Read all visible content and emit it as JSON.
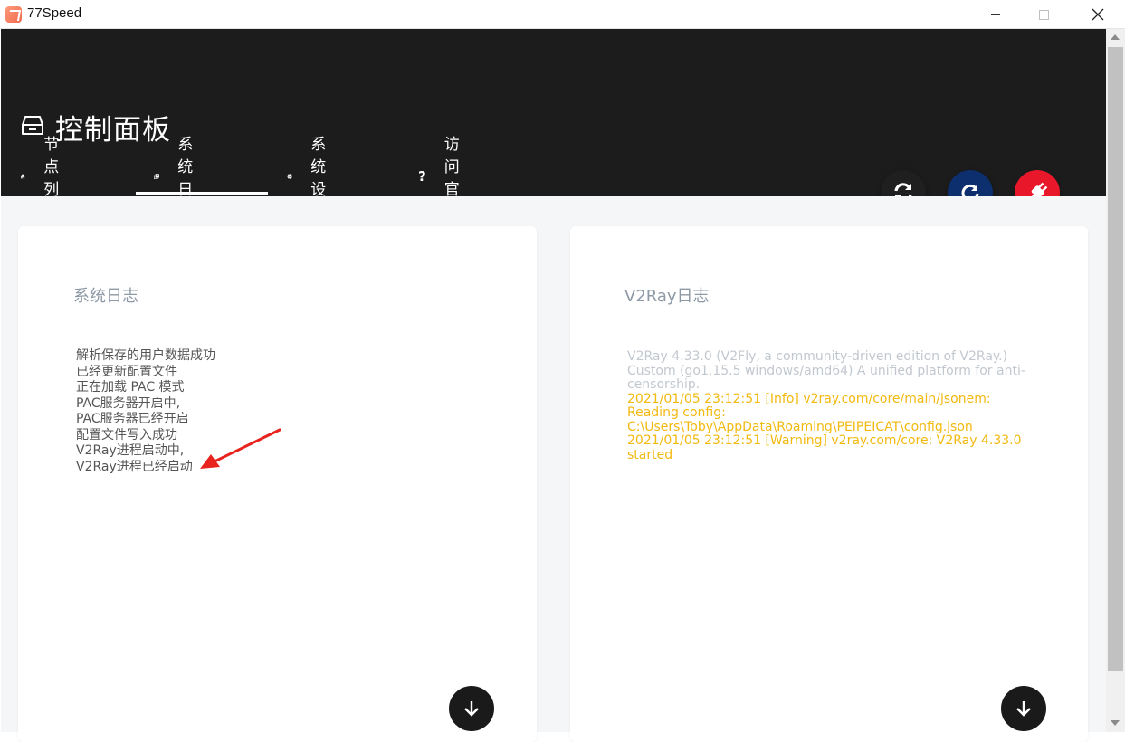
{
  "window": {
    "title": "77Speed",
    "close_glyph": "✕"
  },
  "header": {
    "title": "控制面板",
    "icon": "inbox-icon"
  },
  "tabs": [
    {
      "label": "节点列表",
      "icon": "home-icon",
      "glyph": "⌂"
    },
    {
      "label": "系统日志",
      "icon": "library-icon",
      "glyph": "❐",
      "active": true
    },
    {
      "label": "系统设置",
      "icon": "gear-icon",
      "glyph": "⚙"
    },
    {
      "label": "访问官网",
      "icon": "question-icon",
      "glyph": "?"
    }
  ],
  "actions": [
    {
      "icon": "sync-icon",
      "color": "#1f1f1f"
    },
    {
      "icon": "refresh-icon",
      "color": "#0d2f6e"
    },
    {
      "icon": "plug-icon",
      "color": "#e8172a"
    }
  ],
  "system_log": {
    "title": "系统日志",
    "lines": [
      "解析保存的用户数据成功",
      "已经更新配置文件",
      "正在加载 PAC 模式",
      "PAC服务器开启中,",
      "PAC服务器已经开启",
      "配置文件写入成功",
      "V2Ray进程启动中,",
      "V2Ray进程已经启动"
    ]
  },
  "v2ray_log": {
    "title": "V2Ray日志",
    "intro": "V2Ray 4.33.0 (V2Fly, a community-driven edition of V2Ray.) Custom (go1.15.5 windows/amd64) A unified platform for anti-censorship.",
    "entries": "2021/01/05 23:12:51 [Info] v2ray.com/core/main/jsonem: Reading config: C:\\Users\\Toby\\AppData\\Roaming\\PEIPEICAT\\config.json 2021/01/05 23:12:51 [Warning] v2ray.com/core: V2Ray 4.33.0 started",
    "colors": {
      "intro": "#c2c8cf",
      "entries": "#f2b90f"
    }
  },
  "colors": {
    "header_bg": "#1c1c1c",
    "content_bg": "#f4f6f8",
    "annotation_arrow": "#e8231e"
  }
}
